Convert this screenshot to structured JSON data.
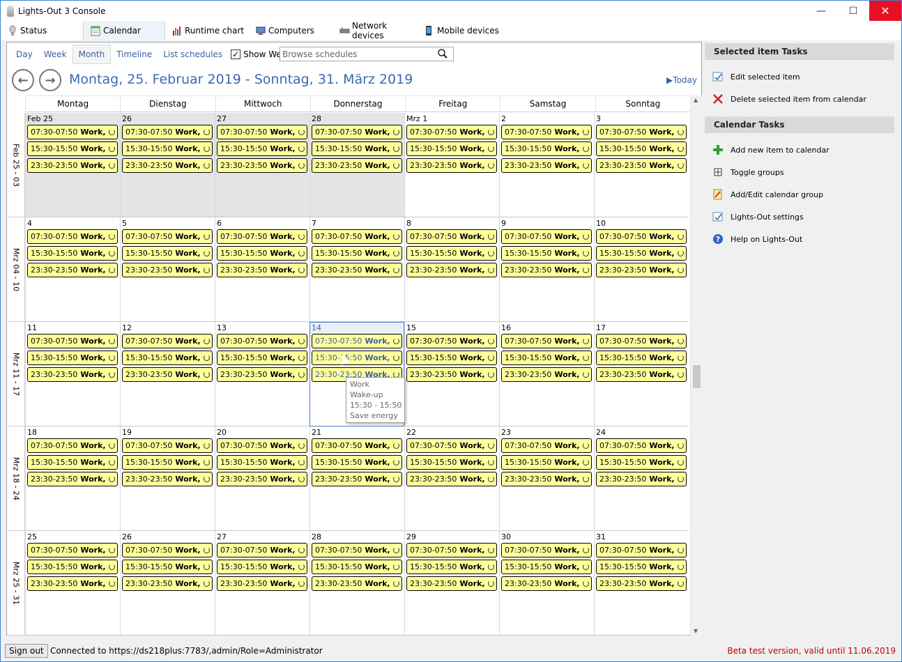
{
  "window": {
    "title": "Lights-Out 3 Console"
  },
  "tabs": [
    {
      "label": "Status",
      "icon": "bulb-icon"
    },
    {
      "label": "Calendar",
      "icon": "calendar-icon"
    },
    {
      "label": "Runtime chart",
      "icon": "chart-icon"
    },
    {
      "label": "Computers",
      "icon": "computer-icon"
    },
    {
      "label": "Network devices",
      "icon": "network-device-icon"
    },
    {
      "label": "Mobile devices",
      "icon": "mobile-icon"
    }
  ],
  "views": {
    "day": "Day",
    "week": "Week",
    "month": "Month",
    "timeline": "Timeline",
    "list": "List schedules",
    "show_weekend": "Show Weekend",
    "search_placeholder": "Browse schedules"
  },
  "navigation": {
    "range": "Montag, 25. Februar 2019 - Sonntag, 31. März 2019",
    "today": "Today"
  },
  "day_headers": [
    "Montag",
    "Dienstag",
    "Mittwoch",
    "Donnerstag",
    "Freitag",
    "Samstag",
    "Sonntag"
  ],
  "weeks": [
    {
      "label": "Feb 25 - 03",
      "days": [
        "Feb 25",
        "26",
        "27",
        "28",
        "Mrz 1",
        "2",
        "3"
      ]
    },
    {
      "label": "Mrz 04 - 10",
      "days": [
        "4",
        "5",
        "6",
        "7",
        "8",
        "9",
        "10"
      ]
    },
    {
      "label": "Mrz 11 - 17",
      "days": [
        "11",
        "12",
        "13",
        "14",
        "15",
        "16",
        "17"
      ]
    },
    {
      "label": "Mrz 18 - 24",
      "days": [
        "18",
        "19",
        "20",
        "21",
        "22",
        "23",
        "24"
      ]
    },
    {
      "label": "Mrz 25 - 31",
      "days": [
        "25",
        "26",
        "27",
        "28",
        "29",
        "30",
        "31"
      ]
    }
  ],
  "appointments": [
    {
      "time": "07:30-07:50",
      "title": "Work,"
    },
    {
      "time": "15:30-15:50",
      "title": "Work,"
    },
    {
      "time": "23:30-23:50",
      "title": "Work,"
    }
  ],
  "tooltip": {
    "lines": [
      "Work",
      "Wake-up",
      "15:30 - 15:50",
      "Save energy"
    ]
  },
  "side": {
    "selected_title": "Selected item Tasks",
    "selected_tasks": [
      {
        "label": "Edit selected item",
        "icon": "edit-icon"
      },
      {
        "label": "Delete selected item from calendar",
        "icon": "delete-icon"
      }
    ],
    "calendar_title": "Calendar Tasks",
    "calendar_tasks": [
      {
        "label": "Add new item to calendar",
        "icon": "add-icon"
      },
      {
        "label": "Toggle groups",
        "icon": "toggle-groups-icon"
      },
      {
        "label": "Add/Edit calendar group",
        "icon": "calendar-group-icon"
      },
      {
        "label": "Lights-Out settings",
        "icon": "settings-icon"
      },
      {
        "label": "Help on Lights-Out",
        "icon": "help-icon"
      }
    ]
  },
  "status": {
    "signout": "Sign out",
    "connection": "Connected to https://ds218plus:7783/,admin/Role=Administrator",
    "beta": "Beta test version, valid until 11.06.2019"
  },
  "colors": {
    "appointment": "#ffff9c",
    "past_day": "#e4e4e4",
    "accent": "#3c6ab0",
    "beta_text": "#c00000"
  }
}
